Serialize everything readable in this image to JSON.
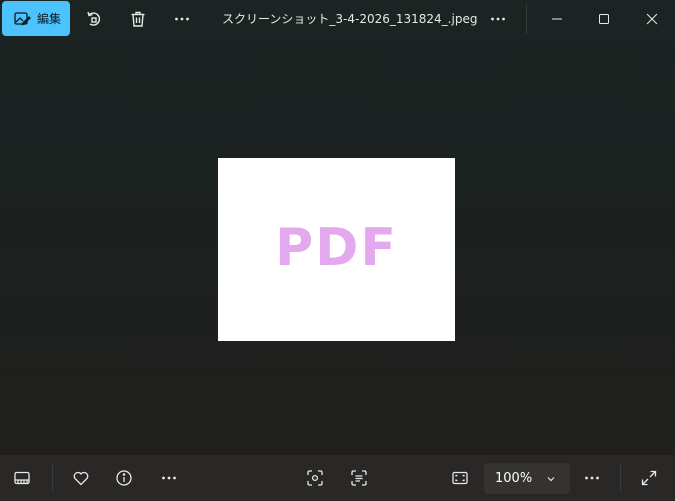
{
  "window": {
    "title": "スクリーンショット_3-4-2026_131824_.jpeg"
  },
  "toolbar": {
    "edit_label": "編集"
  },
  "image": {
    "content_text": "PDF"
  },
  "bottombar": {
    "zoom_value": "100%"
  },
  "colors": {
    "accent": "#4cc2ff",
    "photo_text": "#e4a8ee"
  }
}
